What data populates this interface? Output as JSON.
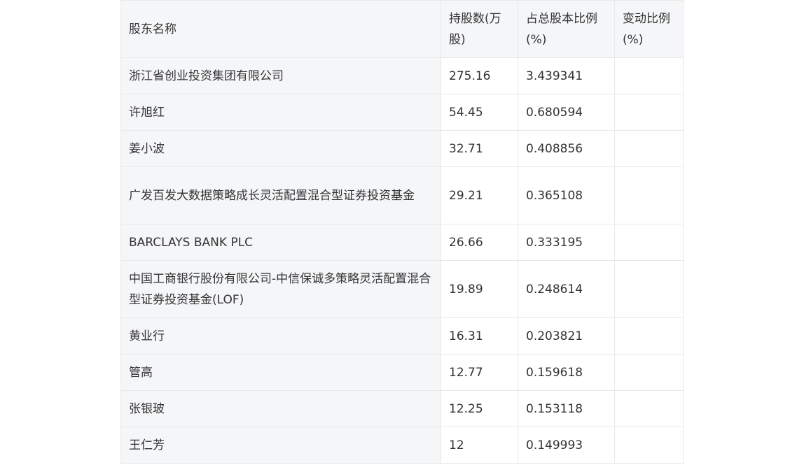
{
  "table": {
    "headers": {
      "name": "股东名称",
      "shares": "持股数(万股)",
      "ratio": "占总股本比例(%)",
      "change": "变动比例(%)"
    },
    "rows": [
      {
        "name": "浙江省创业投资集团有限公司",
        "shares": "275.16",
        "ratio": "3.439341",
        "change": ""
      },
      {
        "name": "许旭红",
        "shares": "54.45",
        "ratio": "0.680594",
        "change": ""
      },
      {
        "name": "姜小波",
        "shares": "32.71",
        "ratio": "0.408856",
        "change": ""
      },
      {
        "name": "广发百发大数据策略成长灵活配置混合型证券投资基金",
        "shares": "29.21",
        "ratio": "0.365108",
        "change": ""
      },
      {
        "name": "BARCLAYS BANK PLC",
        "shares": "26.66",
        "ratio": "0.333195",
        "change": ""
      },
      {
        "name": "中国工商银行股份有限公司-中信保诚多策略灵活配置混合型证券投资基金(LOF)",
        "shares": "19.89",
        "ratio": "0.248614",
        "change": ""
      },
      {
        "name": "黄业行",
        "shares": "16.31",
        "ratio": "0.203821",
        "change": ""
      },
      {
        "name": "管高",
        "shares": "12.77",
        "ratio": "0.159618",
        "change": ""
      },
      {
        "name": "张银玻",
        "shares": "12.25",
        "ratio": "0.153118",
        "change": ""
      },
      {
        "name": "王仁芳",
        "shares": "12",
        "ratio": "0.149993",
        "change": ""
      }
    ]
  }
}
